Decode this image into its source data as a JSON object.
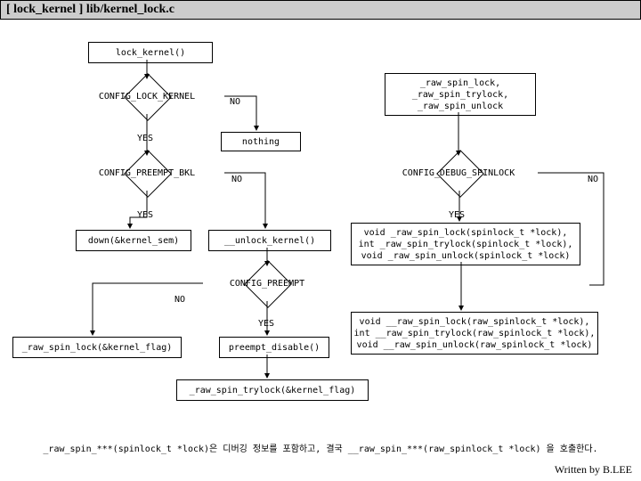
{
  "title": "[ lock_kernel ] lib/kernel_lock.c",
  "nodes": {
    "start": "lock_kernel()",
    "cond1": "CONFIG_LOCK_KERNEL",
    "nothing": "nothing",
    "cond2": "CONFIG_PREEMPT_BKL",
    "down": "down(&kernel_sem)",
    "unlock_kernel": "__unlock_kernel()",
    "raw_spin_group": "_raw_spin_lock,\n_raw_spin_trylock,\n_raw_spin_unlock",
    "cond3": "CONFIG_DEBUG_SPINLOCK",
    "void_raw_spin": "void _raw_spin_lock(spinlock_t *lock),\nint _raw_spin_trylock(spinlock_t *lock),\nvoid _raw_spin_unlock(spinlock_t *lock)",
    "cond4": "CONFIG_PREEMPT",
    "raw_spin_lock_flag": "_raw_spin_lock(&kernel_flag)",
    "preempt_disable": "preempt_disable()",
    "void_raw_spin2": "void __raw_spin_lock(raw_spinlock_t *lock),\nint __raw_spin_trylock(raw_spinlock_t *lock),\nvoid __raw_spin_unlock(raw_spinlock_t *lock)",
    "raw_spin_trylock_flag": "_raw_spin_trylock(&kernel_flag)"
  },
  "labels": {
    "yes": "YES",
    "no": "NO"
  },
  "footer_note": "_raw_spin_***(spinlock_t *lock)은 디버깅 정보를 포함하고, 결국 __raw_spin_***(raw_spinlock_t *lock) 을 호출한다.",
  "footer_credit": "Written by B.LEE"
}
